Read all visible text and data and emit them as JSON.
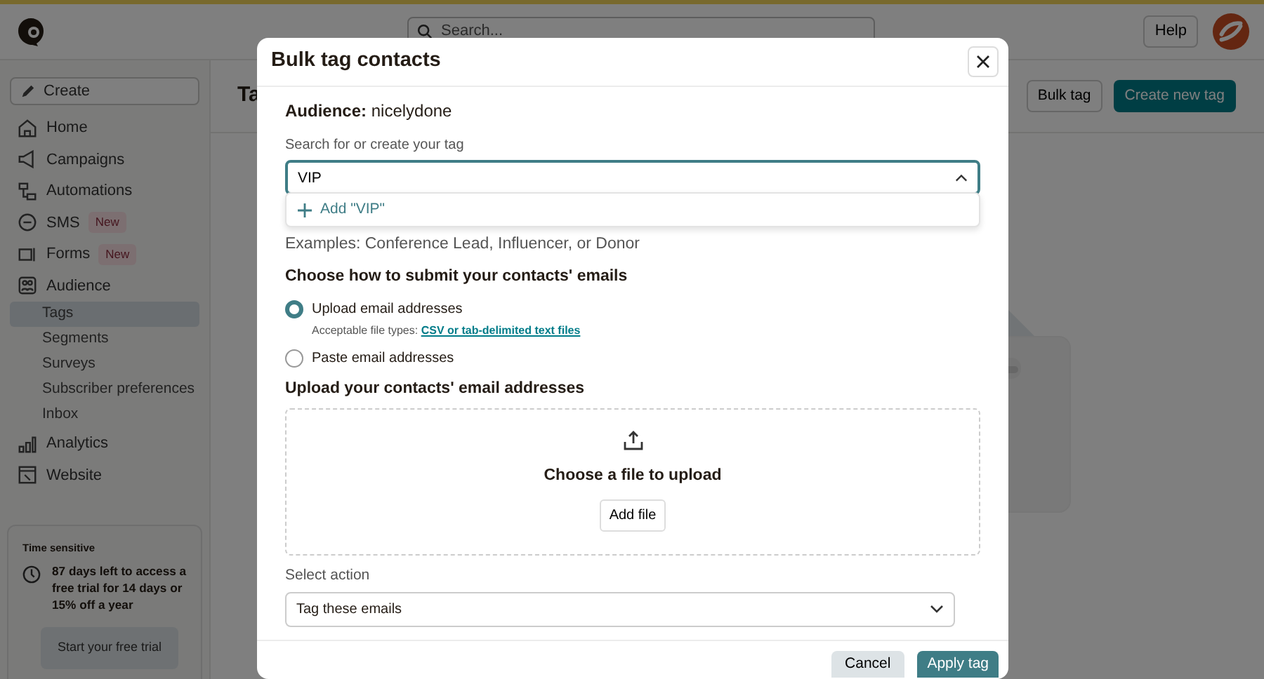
{
  "topbar": {
    "search_placeholder": "Search...",
    "help": "Help"
  },
  "sidebar": {
    "create": "Create",
    "items": [
      {
        "label": "Home",
        "selected": false
      },
      {
        "label": "Campaigns",
        "selected": false
      },
      {
        "label": "Automations",
        "selected": false
      },
      {
        "label": "SMS",
        "badge": "New",
        "selected": false
      },
      {
        "label": "Forms",
        "badge": "New",
        "selected": false
      },
      {
        "label": "Audience",
        "selected": false,
        "children": [
          {
            "label": "Tags",
            "selected": true
          },
          {
            "label": "Segments",
            "selected": false
          },
          {
            "label": "Surveys",
            "selected": false
          },
          {
            "label": "Subscriber preferences",
            "selected": false
          },
          {
            "label": "Inbox",
            "selected": false
          }
        ]
      },
      {
        "label": "Analytics",
        "selected": false
      },
      {
        "label": "Website",
        "selected": false
      }
    ]
  },
  "trial_card": {
    "heading": "Time sensitive",
    "message": "87 days left to access a free trial for 14 days or 15% off a year",
    "button": "Start your free trial"
  },
  "page": {
    "title": "Ta",
    "buttons": [
      "Bulk tag",
      "Create new tag"
    ]
  },
  "modal": {
    "title": "Bulk tag contacts",
    "audience": "**Audience:** nicelydone",
    "tag_field": {
      "label": "Search for or create your tag",
      "value": "VIP",
      "expanded": true
    },
    "suggestions": [
      "Add \"VIP\""
    ],
    "hint": "Examples: Conference Lead, Influencer, or Donor",
    "submit_heading": "Choose how to submit your contacts' emails",
    "options": [
      {
        "label": "Upload email addresses",
        "selected": true,
        "note": "Acceptable file types:",
        "note_link": "CSV or tab-delimited text files"
      },
      {
        "label": "Paste email addresses",
        "selected": false
      }
    ],
    "upload_heading": "Upload your contacts' email addresses",
    "upload": {
      "prompt": "Choose a file to upload",
      "button": "Add file"
    },
    "action": {
      "label": "Select action",
      "value": "Tag these emails"
    },
    "buttons": {
      "cancel": "Cancel",
      "apply": "Apply tag"
    }
  }
}
